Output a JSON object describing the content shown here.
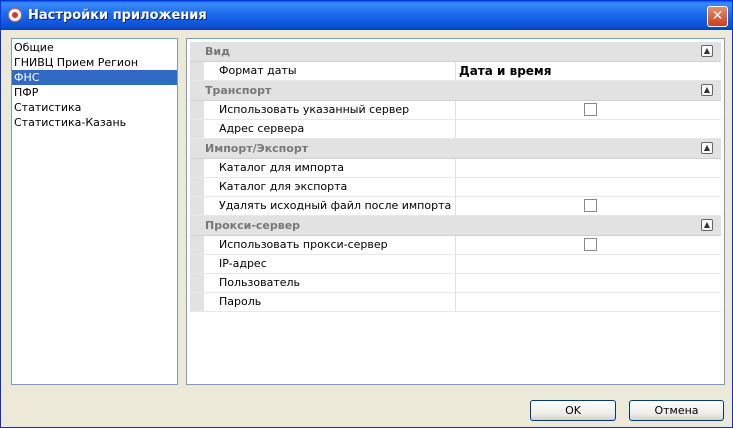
{
  "window": {
    "title": "Настройки приложения"
  },
  "sidebar": {
    "items": [
      {
        "label": "Общие"
      },
      {
        "label": "ГНИВЦ Прием Регион"
      },
      {
        "label": "ФНС"
      },
      {
        "label": "ПФР"
      },
      {
        "label": "Статистика"
      },
      {
        "label": "Статистика-Казань"
      }
    ],
    "selected": "ФНС"
  },
  "grid": {
    "categories": [
      {
        "label": "Вид",
        "properties": [
          {
            "name": "Формат даты",
            "value": "Дата и время",
            "type": "text"
          }
        ]
      },
      {
        "label": "Транспорт",
        "properties": [
          {
            "name": "Использовать указанный сервер",
            "type": "checkbox",
            "checked": false
          },
          {
            "name": "Адрес сервера",
            "value": "",
            "type": "text"
          }
        ]
      },
      {
        "label": "Импорт/Экспорт",
        "properties": [
          {
            "name": "Каталог для импорта",
            "value": "",
            "type": "text"
          },
          {
            "name": "Каталог для экспорта",
            "value": "",
            "type": "text"
          },
          {
            "name": "Удалять исходный файл после импорта",
            "type": "checkbox",
            "checked": false
          }
        ]
      },
      {
        "label": "Прокси-сервер",
        "properties": [
          {
            "name": "Использовать прокси-сервер",
            "type": "checkbox",
            "checked": false
          },
          {
            "name": "IP-адрес",
            "value": "",
            "type": "text"
          },
          {
            "name": "Пользователь",
            "value": "",
            "type": "text"
          },
          {
            "name": "Пароль",
            "value": "",
            "type": "text"
          }
        ]
      }
    ]
  },
  "buttons": {
    "ok": "OK",
    "cancel": "Отмена"
  },
  "colors": {
    "selection": "#316ac5",
    "titlebar": "#0a5fe0",
    "category_bg": "#e2e2e2"
  },
  "icons": {
    "collapse": "chevron-up-icon",
    "close": "close-icon",
    "app": "app-icon"
  }
}
